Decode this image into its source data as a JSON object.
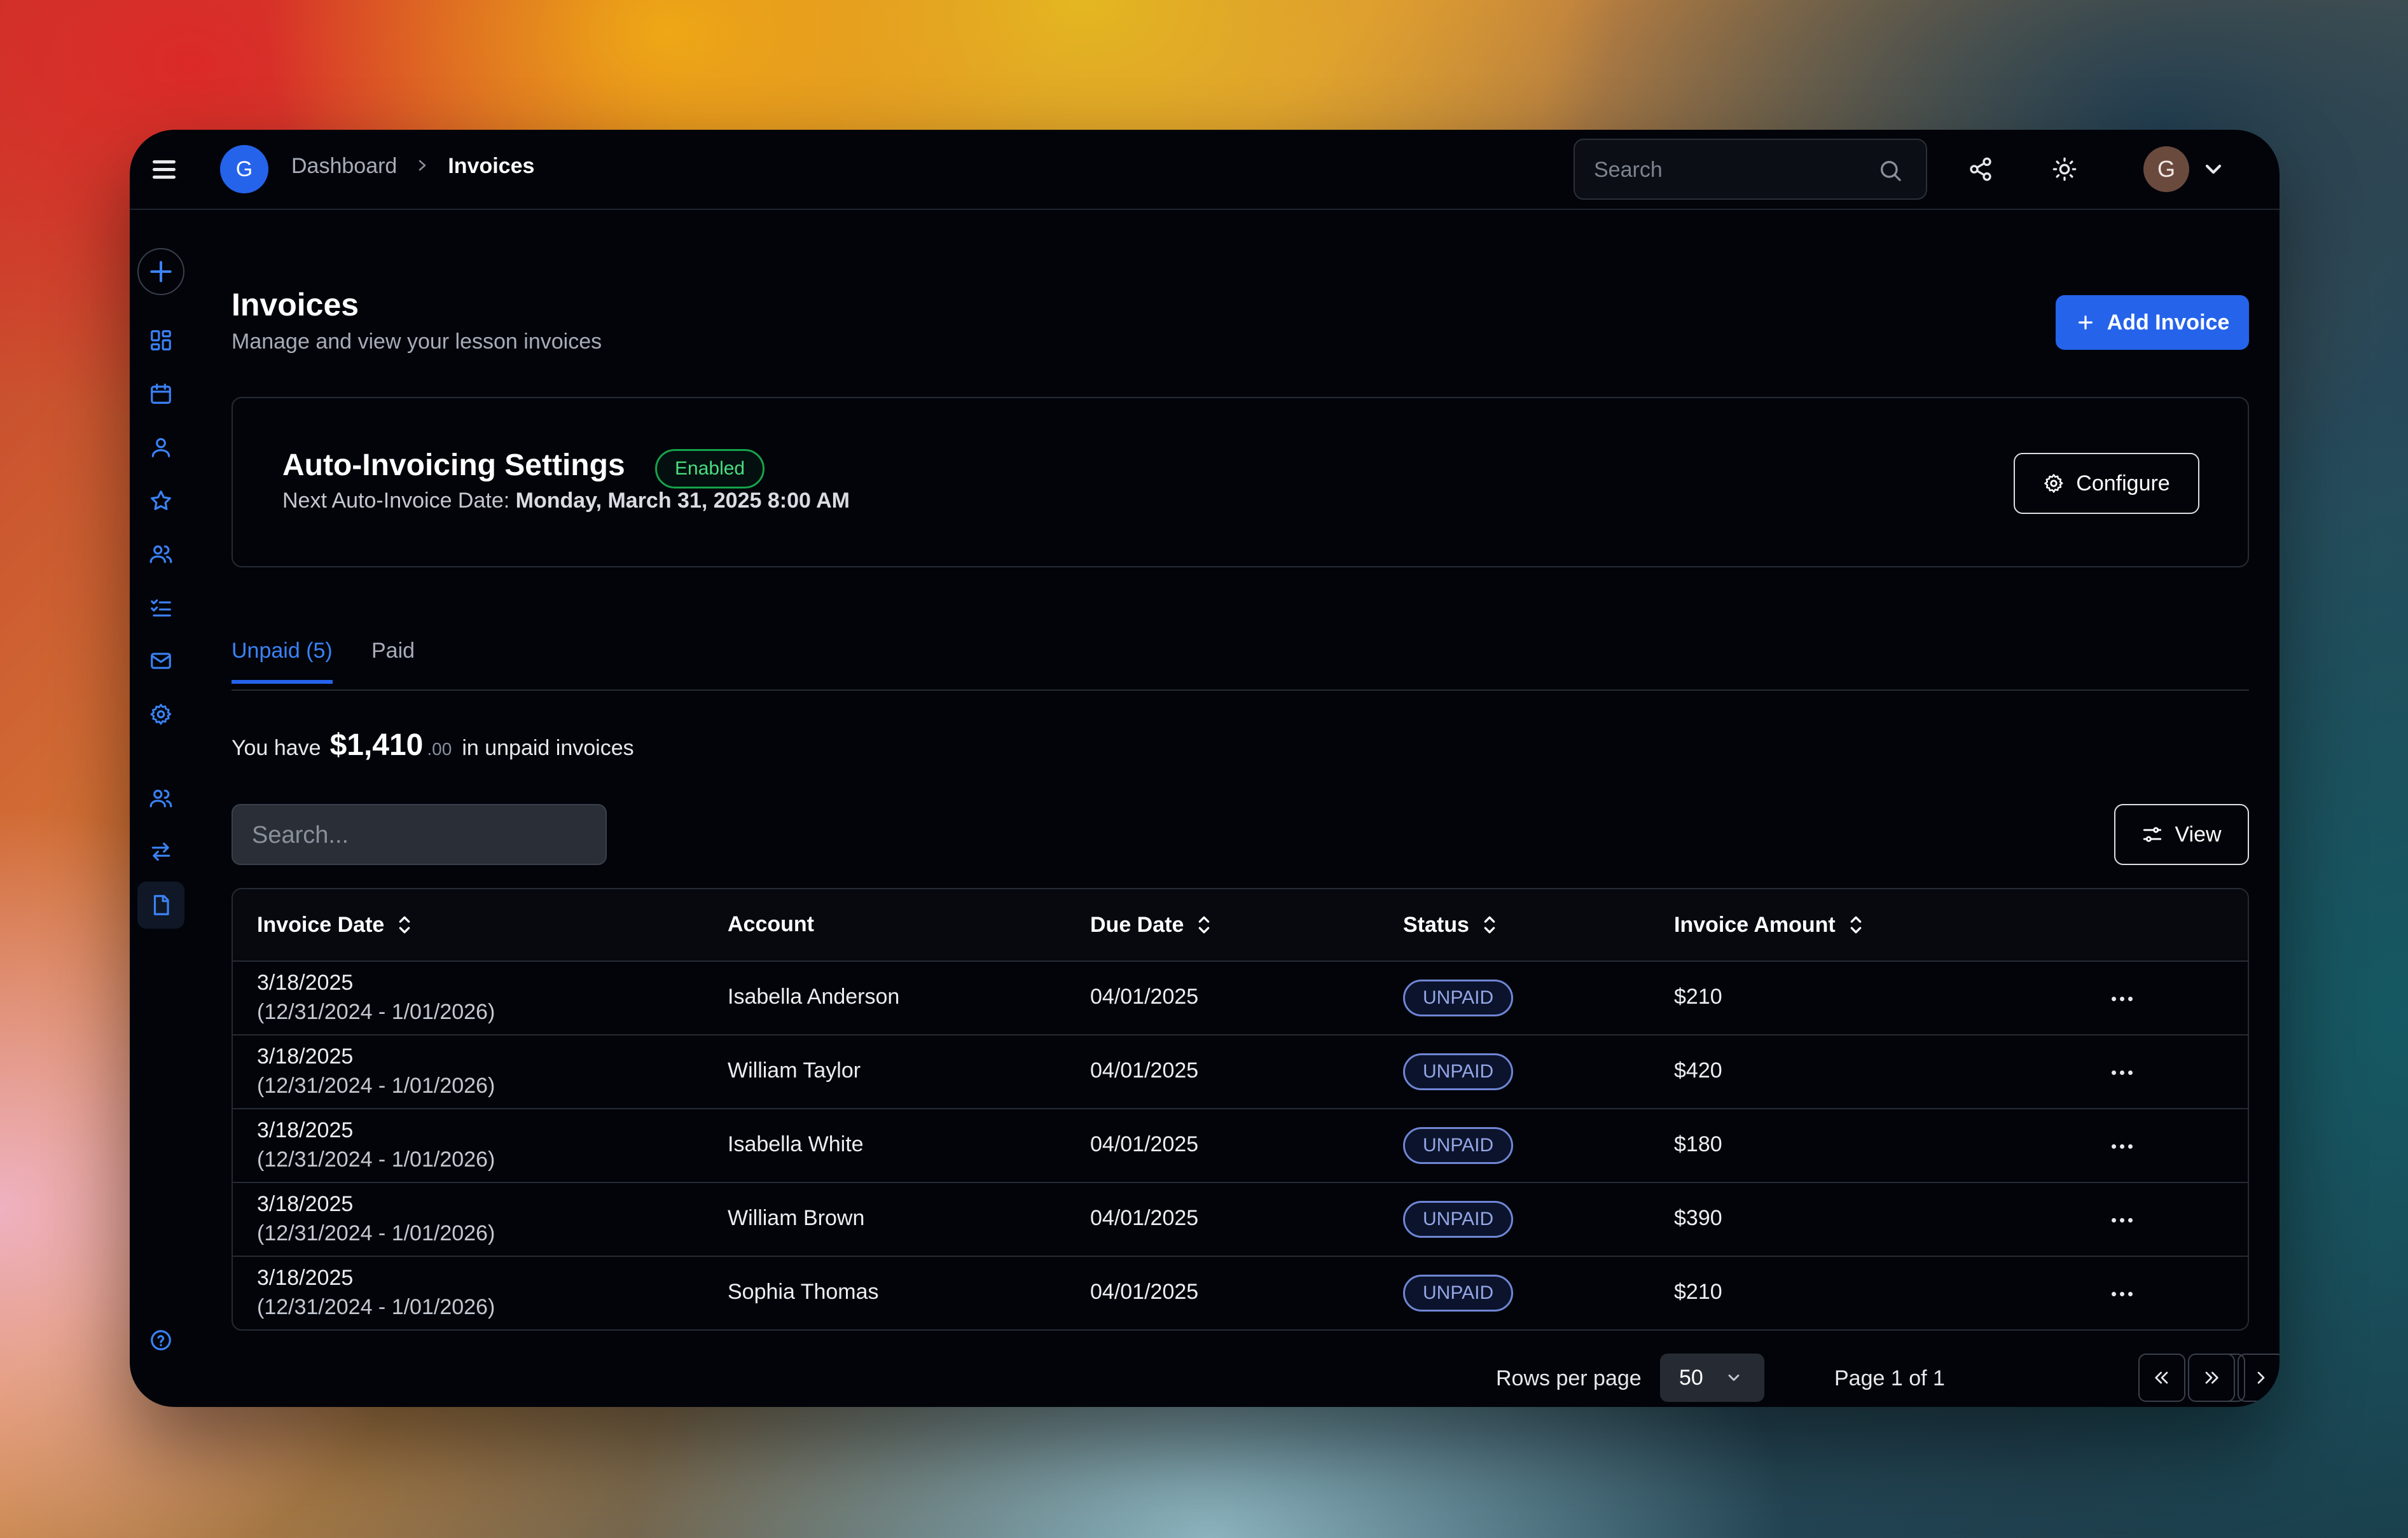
{
  "header": {
    "logo_letter": "G",
    "breadcrumb": {
      "parent": "Dashboard",
      "current": "Invoices"
    },
    "search_placeholder": "Search",
    "user_initial": "G"
  },
  "sidebar": {
    "items": [
      "add-icon",
      "dashboard-icon",
      "calendar-icon",
      "user-icon",
      "star-icon",
      "users-icon",
      "checklist-icon",
      "mail-icon",
      "settings-icon",
      "team-icon",
      "transfer-icon",
      "invoice-icon",
      "help-icon"
    ],
    "active": "invoice-icon",
    "accent": "#3b82f6"
  },
  "page": {
    "title": "Invoices",
    "subtitle": "Manage and view your lesson invoices",
    "add_button": "Add Invoice"
  },
  "auto_invoicing": {
    "title": "Auto-Invoicing Settings",
    "status": "Enabled",
    "next_label": "Next Auto-Invoice Date:",
    "next_value": "Monday, March 31, 2025 8:00 AM",
    "configure_button": "Configure"
  },
  "tabs": [
    {
      "label": "Unpaid (5)",
      "active": true
    },
    {
      "label": "Paid",
      "active": false
    }
  ],
  "summary": {
    "prefix": "You have",
    "amount_main": "$1,410",
    "amount_cents": ".00",
    "suffix": "in unpaid invoices"
  },
  "table": {
    "search_placeholder": "Search...",
    "view_button": "View",
    "columns": [
      "Invoice Date",
      "Account",
      "Due Date",
      "Status",
      "Invoice Amount"
    ],
    "rows": [
      {
        "date": "3/18/2025",
        "range": "(12/31/2024 - 1/01/2026)",
        "account": "Isabella Anderson",
        "due": "04/01/2025",
        "status": "UNPAID",
        "amount": "$210"
      },
      {
        "date": "3/18/2025",
        "range": "(12/31/2024 - 1/01/2026)",
        "account": "William Taylor",
        "due": "04/01/2025",
        "status": "UNPAID",
        "amount": "$420"
      },
      {
        "date": "3/18/2025",
        "range": "(12/31/2024 - 1/01/2026)",
        "account": "Isabella White",
        "due": "04/01/2025",
        "status": "UNPAID",
        "amount": "$180"
      },
      {
        "date": "3/18/2025",
        "range": "(12/31/2024 - 1/01/2026)",
        "account": "William Brown",
        "due": "04/01/2025",
        "status": "UNPAID",
        "amount": "$390"
      },
      {
        "date": "3/18/2025",
        "range": "(12/31/2024 - 1/01/2026)",
        "account": "Sophia Thomas",
        "due": "04/01/2025",
        "status": "UNPAID",
        "amount": "$210"
      }
    ]
  },
  "pagination": {
    "rows_label": "Rows per page",
    "rows_value": "50",
    "page_label": "Page 1 of 1"
  }
}
